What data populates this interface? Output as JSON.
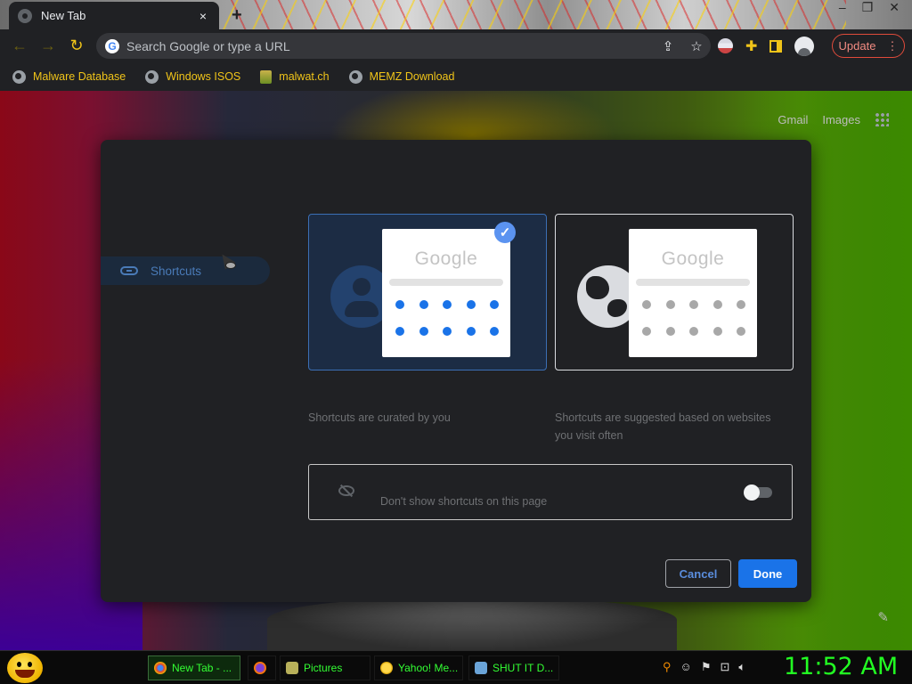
{
  "browser": {
    "tab_title": "New Tab",
    "tab_close": "×",
    "new_tab": "+",
    "omnibox_placeholder": "Search Google or type a URL",
    "update_label": "Update",
    "update_menu": "⋮"
  },
  "bookmarks": [
    {
      "label": "Malware Database",
      "icon": "globe-icon"
    },
    {
      "label": "Windows ISOS",
      "icon": "globe-icon"
    },
    {
      "label": "malwat.ch",
      "icon": "document-icon"
    },
    {
      "label": "MEMZ Download",
      "icon": "globe-icon"
    }
  ],
  "ntp": {
    "gmail": "Gmail",
    "images": "Images"
  },
  "dialog": {
    "sidebar_item": "Shortcuts",
    "option_my": {
      "card_logo": "Google",
      "selected": true,
      "description": "Shortcuts are curated by you"
    },
    "option_most": {
      "card_logo": "Google",
      "selected": false,
      "description": "Shortcuts are suggested based on websites you visit often"
    },
    "hide_label": "Don't show shortcuts on this page",
    "hide_toggle_on": false,
    "cancel": "Cancel",
    "done": "Done"
  },
  "taskbar": {
    "items": [
      {
        "label": "New Tab - ...",
        "active": true
      },
      {
        "label": "",
        "active": false
      },
      {
        "label": "Pictures",
        "active": false
      },
      {
        "label": "Yahoo! Me...",
        "active": false
      },
      {
        "label": "SHUT IT D...",
        "active": false
      }
    ],
    "clock": "11:52 AM"
  },
  "colors": {
    "accent": "#1a73e8",
    "bookmark_text": "#f0c419",
    "clock": "#22ff22",
    "update_border": "#e04b3b"
  }
}
